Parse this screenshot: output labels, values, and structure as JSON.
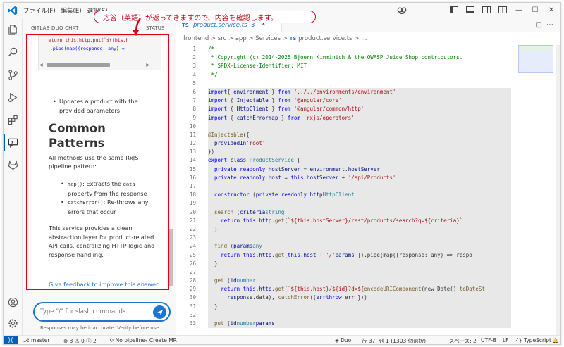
{
  "titlebar": {
    "menu": [
      "ファイル(F)",
      "編集(E)",
      "選択(S)"
    ]
  },
  "annotation": {
    "callout_text": "応答（英語）が返ってきますので、内容を確認します。"
  },
  "sidebar": {
    "header": "GITLAB DUO CHAT",
    "status_label": "STATUS",
    "code_line1": "return this.http.put(`${this.h",
    "code_line2": ".pipe(map((response: any) =",
    "bullet_updates": "Updates a product with the provided parameters",
    "heading": "Common Patterns",
    "intro": "All methods use the same RxJS pipeline pattern:",
    "bullet_map_code": "map()",
    "bullet_map_text1": ": Extracts the ",
    "bullet_map_code2": "data",
    "bullet_map_text2": " property from the response",
    "bullet_catch_code": "catchError()",
    "bullet_catch_text": ": Re-throws any errors that occur",
    "summary": "This service provides a clean abstraction layer for product-related API calls, centralizing HTTP logic and response handling.",
    "feedback_link": "Give feedback to improve this answer.",
    "input_placeholder": "Type \"/\" for slash commands",
    "disclaimer": "Responses may be inaccurate. Verify before use."
  },
  "editor": {
    "tab_name": "product.service.ts",
    "tab_count": "3",
    "tab_lang": "TS",
    "breadcrumb": [
      "frontend",
      "src",
      "app",
      "Services",
      "product.service.ts"
    ],
    "line_numbers": [
      "1",
      "2",
      "3",
      "4",
      "5",
      "6",
      "7",
      "8",
      "9",
      "10",
      "11",
      "12",
      "13",
      "14",
      "15",
      "16",
      "17",
      "18",
      "19",
      "20",
      "21",
      "22",
      "23",
      "24",
      "25",
      "26",
      "27",
      "28",
      "29",
      "30",
      "31",
      "32",
      "33"
    ]
  },
  "statusbar": {
    "branch": "master",
    "errors": "3",
    "warnings": "0",
    "infos": "2",
    "pipeline": "No pipeline",
    "create_mr": "Create MR",
    "duo": "Duo",
    "position": "行 37, 列 1 (1303 個選択)",
    "spaces": "スペース: 2",
    "encoding": "UTF-8",
    "eol": "LF",
    "language": "TypeScript"
  },
  "colors": {
    "accent": "#005fb8",
    "annotation_red": "#e3001b",
    "link": "#1f75cb"
  }
}
